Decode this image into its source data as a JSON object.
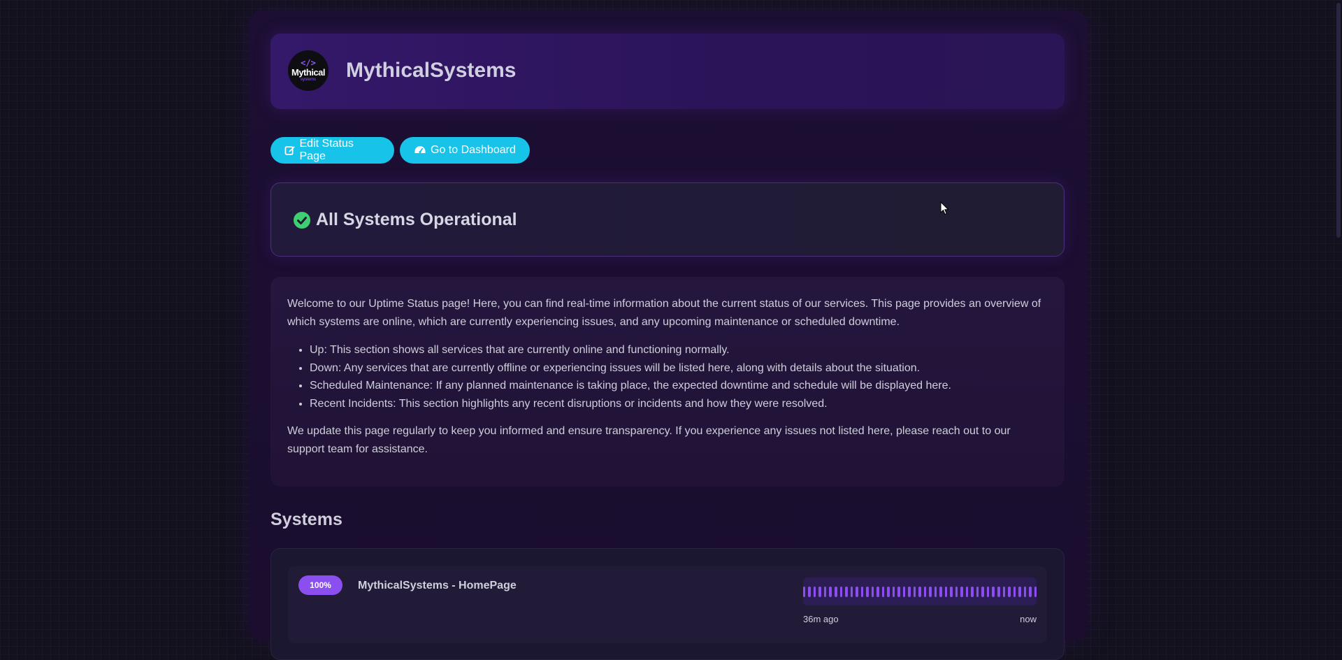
{
  "header": {
    "logo_code": "</>",
    "logo_word": "Mythical",
    "logo_sub": "systems",
    "brand_name": "MythicalSystems"
  },
  "actions": {
    "edit_label": "Edit Status Page",
    "dashboard_label": "Go to Dashboard"
  },
  "status": {
    "text": "All Systems Operational",
    "icon": "check-circle-icon",
    "color": "#3fcf73"
  },
  "description": {
    "intro": "Welcome to our Uptime Status page! Here, you can find real-time information about the current status of our services. This page provides an overview of which systems are online, which are currently experiencing issues, and any upcoming maintenance or scheduled downtime.",
    "items": [
      "Up: This section shows all services that are currently online and functioning normally.",
      "Down: Any services that are currently offline or experiencing issues will be listed here, along with details about the situation.",
      "Scheduled Maintenance: If any planned maintenance is taking place, the expected downtime and schedule will be displayed here.",
      "Recent Incidents: This section highlights any recent disruptions or incidents and how they were resolved."
    ],
    "outro": "We update this page regularly to keep you informed and ensure transparency. If you experience any issues not listed here, please reach out to our support team for assistance."
  },
  "systems": {
    "title": "Systems",
    "items": [
      {
        "uptime": "100%",
        "name": "MythicalSystems - HomePage",
        "heartbeat_count": 45,
        "heartbeat_status": "up",
        "time_start": "36m ago",
        "time_end": "now"
      }
    ]
  },
  "colors": {
    "accent_button": "#18c3ea",
    "badge": "#8b4ff0",
    "heartbeat": "#8b4ff0"
  }
}
